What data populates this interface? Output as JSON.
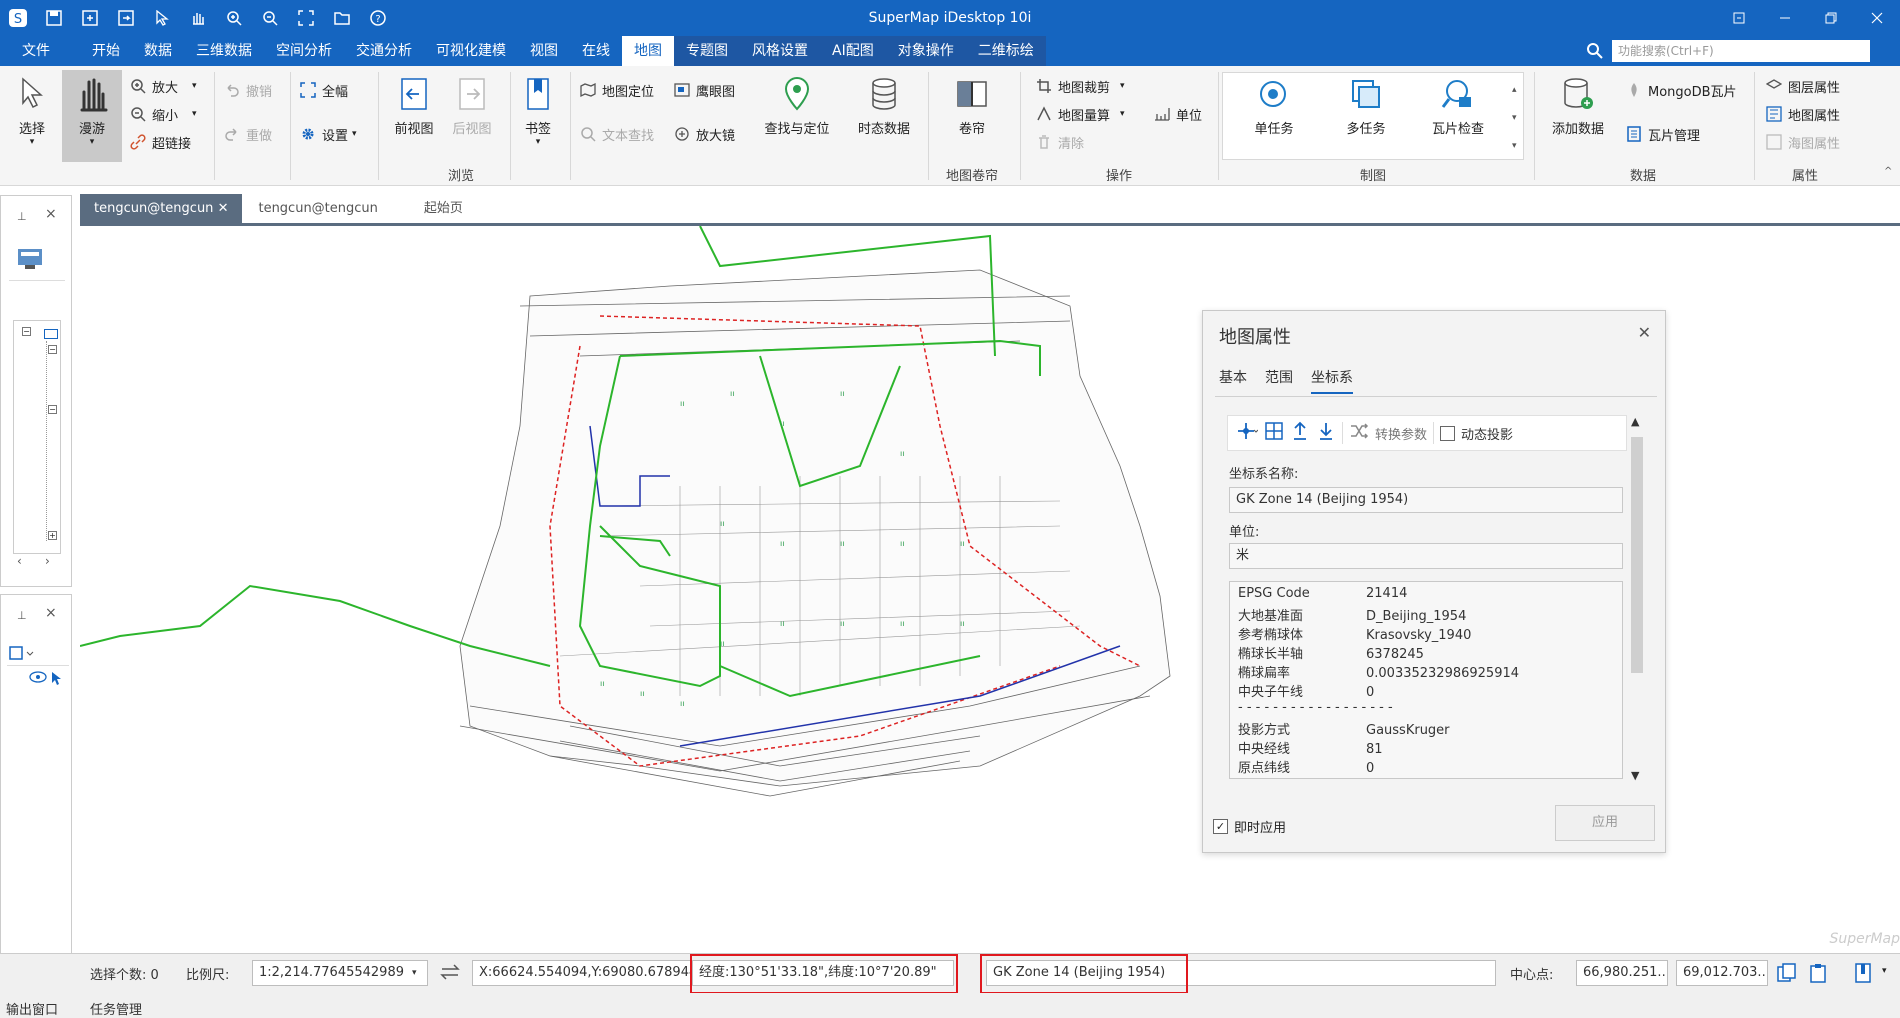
{
  "app": {
    "title": "SuperMap iDesktop 10i"
  },
  "menu": {
    "items": [
      "文件",
      "开始",
      "数据",
      "三维数据",
      "空间分析",
      "交通分析",
      "可视化建模",
      "视图",
      "在线",
      "地图",
      "专题图",
      "风格设置",
      "AI配图",
      "对象操作",
      "二维标绘"
    ],
    "active": "地图",
    "search_placeholder": "功能搜索(Ctrl+F)"
  },
  "ribbon": {
    "select": "选择",
    "pan": "漫游",
    "zoom_in": "放大",
    "zoom_out": "缩小",
    "hyperlink": "超链接",
    "undo": "撤销",
    "redo": "重做",
    "full_extent": "全幅",
    "settings": "设置",
    "prev_view": "前视图",
    "next_view": "后视图",
    "bookmark": "书签",
    "map_locate": "地图定位",
    "eagle_eye": "鹰眼图",
    "text_find": "文本查找",
    "magnifier": "放大镜",
    "find_locate": "查找与定位",
    "temporal": "时态数据",
    "curtain": "卷帘",
    "browse_group": "浏览",
    "curtain_group": "地图卷帘",
    "map_clip": "地图裁剪",
    "map_measure": "地图量算",
    "clear": "清除",
    "unit": "单位",
    "ops_group": "操作",
    "single_task": "单任务",
    "multi_task": "多任务",
    "tile_check": "瓦片检查",
    "cartography_group": "制图",
    "add_data": "添加数据",
    "mongodb_tile": "MongoDB瓦片",
    "tile_manage": "瓦片管理",
    "data_group": "数据",
    "layer_props": "图层属性",
    "map_props": "地图属性",
    "chart_props": "海图属性",
    "props_group": "属性"
  },
  "tabs": [
    {
      "label": "tengcun@tengcun",
      "active": true
    },
    {
      "label": "tengcun@tengcun",
      "active": false
    },
    {
      "label": "起始页",
      "active": false
    }
  ],
  "dialog": {
    "title": "地图属性",
    "tabs": [
      "基本",
      "范围",
      "坐标系"
    ],
    "active_tab": "坐标系",
    "convert_params": "转换参数",
    "dynamic_projection": "动态投影",
    "cs_name_label": "坐标系名称:",
    "cs_name": "GK Zone 14    (Beijing 1954)",
    "unit_label": "单位:",
    "unit_value": "米",
    "info": [
      {
        "k": "EPSG Code",
        "v": "21414"
      },
      {
        "k": "大地基准面",
        "v": "D_Beijing_1954"
      },
      {
        "k": "参考椭球体",
        "v": "Krasovsky_1940"
      },
      {
        "k": "椭球长半轴",
        "v": "6378245"
      },
      {
        "k": "椭球扁率",
        "v": "0.00335232986925914"
      },
      {
        "k": "中央子午线",
        "v": "0"
      },
      {
        "k": "- - - - - - - - - - - - - - - - - -",
        "v": ""
      },
      {
        "k": "投影方式",
        "v": "GaussKruger"
      },
      {
        "k": "中央经线",
        "v": "81"
      },
      {
        "k": "原点纬线",
        "v": "0"
      }
    ],
    "apply_now": "即时应用",
    "apply": "应用"
  },
  "status": {
    "selected_count": "选择个数: 0",
    "scale_label": "比例尺:",
    "scale_value": "1:2,214.77645542989",
    "xy": "X:66624.554094,Y:69080.678944",
    "lonlat": "经度:130°51'33.18\",纬度:10°7'20.89\"",
    "cs": "GK Zone 14    (Beijing 1954)",
    "center_label": "中心点:",
    "center_x": "66,980.251...",
    "center_y": "69,012.703..."
  },
  "bottom": {
    "output": "输出窗口",
    "task": "任务管理"
  },
  "colors": {
    "brand": "#1565c0",
    "highlight": "#e0181e"
  }
}
